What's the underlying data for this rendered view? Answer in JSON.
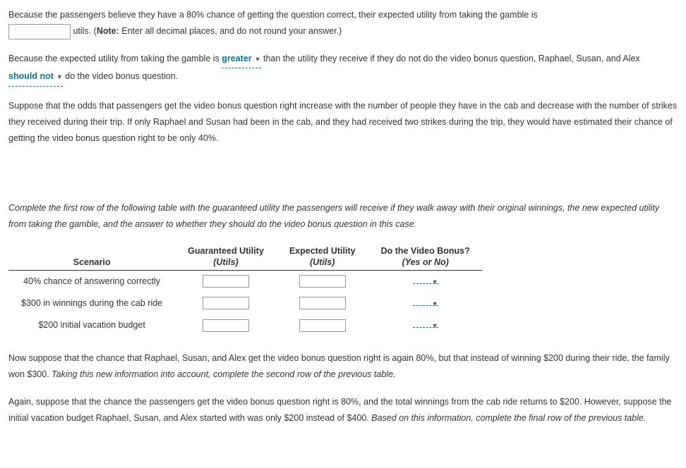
{
  "p1": {
    "t1": "Because the passengers believe they have a 80% chance of getting the question correct, their expected utility from taking the gamble is",
    "t2": " utils. (",
    "note_label": "Note:",
    "t3": " Enter all decimal places, and do not round your answer.)"
  },
  "p2": {
    "t1": "Because the expected utility from taking the gamble is ",
    "drop1": "greater",
    "t2": " than the utility they receive if they do not do the video bonus question, Raphael, Susan, and Alex ",
    "drop2": "should not",
    "t3": " do the video bonus question."
  },
  "p3": "Suppose that the odds that passengers get the video bonus question right increase with the number of people they have in the cab and decrease with the number of strikes they received during their trip. If only Raphael and Susan had been in the cab, and they had received two strikes during the trip, they would have estimated their chance of getting the video bonus question right to be only 40%.",
  "p4": "Complete the first row of the following table with the guaranteed utility the passengers will receive if they walk away with their original winnings, the new expected utility from taking the gamble, and the answer to whether they should do the video bonus question in this case.",
  "table": {
    "headers": {
      "scenario": "Scenario",
      "gu_top": "Guaranteed Utility",
      "gu_sub": "(Utils)",
      "eu_top": "Expected Utility",
      "eu_sub": "(Utils)",
      "bonus_top": "Do the Video Bonus?",
      "bonus_sub": "(Yes or No)"
    },
    "rows": [
      {
        "scenario": "40% chance of answering correctly"
      },
      {
        "scenario": "$300 in winnings during the cab ride"
      },
      {
        "scenario": "$200 initial vacation budget"
      }
    ]
  },
  "p5": {
    "t1": "Now suppose that the chance that Raphael, Susan, and Alex get the video bonus question right is again 80%, but that instead of winning $200 during their ride, the family won $300. ",
    "t2": "Taking this new information into account, complete the second row of the previous table."
  },
  "p6": {
    "t1": "Again, suppose that the chance the passengers get the video bonus question right is 80%, and the total winnings from the cab ride returns to $200. However, suppose the initial vacation budget Raphael, Susan, and Alex started with was only $200 instead of $400. ",
    "t2": "Based on this information, complete the final row of the previous table."
  }
}
